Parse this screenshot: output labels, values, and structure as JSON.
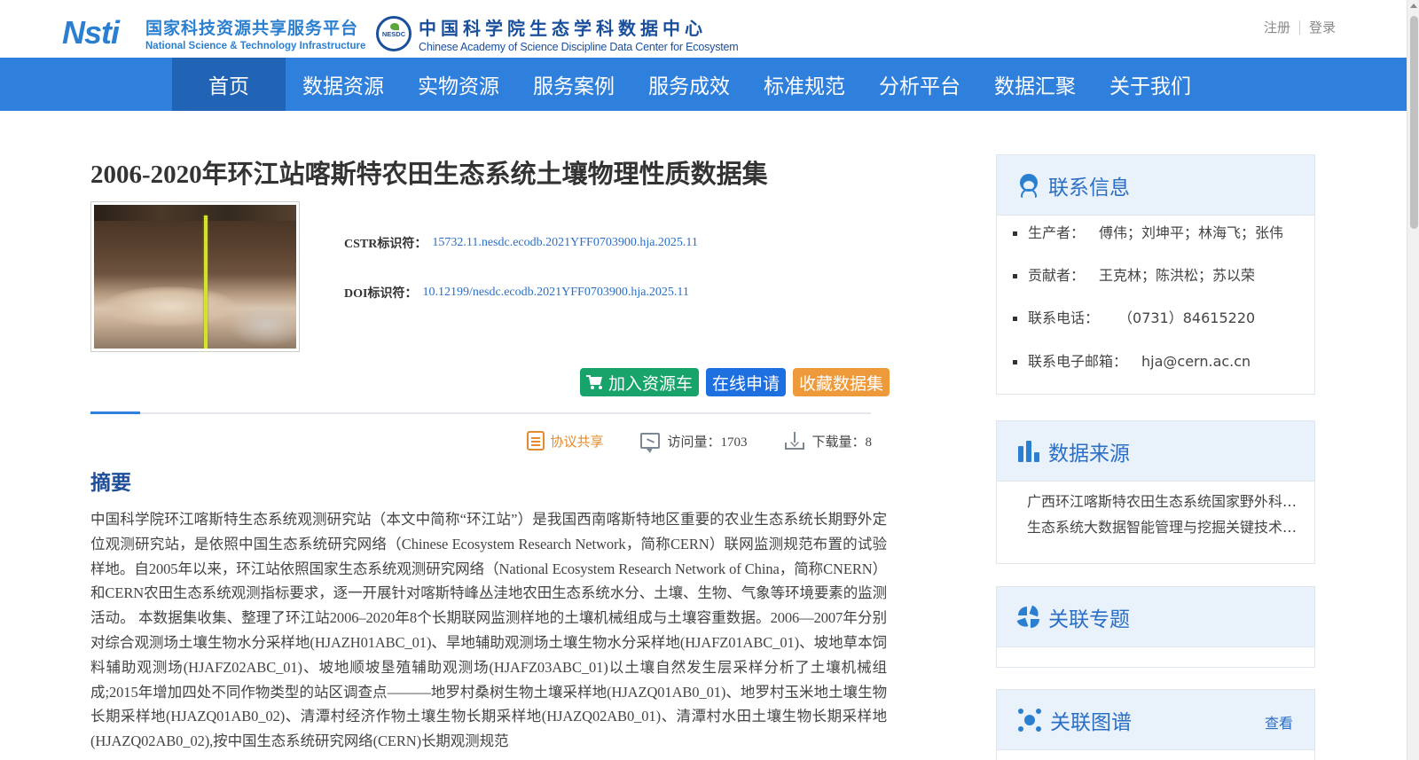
{
  "header": {
    "nsti_mark": "Nsti",
    "nsti_cn": "国家科技资源共享服务平台",
    "nsti_en": "National Science & Technology Infrastructure",
    "nesdc_mark": "NESDC",
    "nesdc_cn": "中国科学院生态学科数据中心",
    "nesdc_en": "Chinese Academy of Science Discipline Data Center for Ecosystem",
    "register": "注册",
    "login": "登录"
  },
  "nav": {
    "items": [
      "首页",
      "数据资源",
      "实物资源",
      "服务案例",
      "服务成效",
      "标准规范",
      "分析平台",
      "数据汇聚",
      "关于我们"
    ],
    "active": "首页"
  },
  "dataset": {
    "title": "2006-2020年环江站喀斯特农田生态系统土壤物理性质数据集",
    "cstr_label": "CSTR标识符：",
    "cstr_value": "15732.11.nesdc.ecodb.2021YFF0703900.hja.2025.11",
    "doi_label": "DOI标识符：",
    "doi_value": "10.12199/nesdc.ecodb.2021YFF0703900.hja.2025.11"
  },
  "buttons": {
    "add_cart": "加入资源车",
    "apply": "在线申请",
    "favorite": "收藏数据集"
  },
  "stats": {
    "share": "协议共享",
    "visits": "访问量：1703",
    "downloads": "下载量：8"
  },
  "abstract": {
    "title": "摘要",
    "text": "中国科学院环江喀斯特生态系统观测研究站（本文中简称“环江站”）是我国西南喀斯特地区重要的农业生态系统长期野外定位观测研究站，是依照中国生态系统研究网络（Chinese Ecosystem Research Network，简称CERN）联网监测规范布置的试验样地。自2005年以来，环江站依照国家生态系统观测研究网络（National Ecosystem Research Network of China，简称CNERN）和CERN农田生态系统观测指标要求，逐一开展针对喀斯特峰丛洼地农田生态系统水分、土壤、生物、气象等环境要素的监测活动。 本数据集收集、整理了环江站2006–2020年8个长期联网监测样地的土壤机械组成与土壤容重数据。2006—2007年分别对综合观测场土壤生物水分采样地(HJAZH01ABC_01)、旱地辅助观测场土壤生物水分采样地(HJAFZ01ABC_01)、坡地草本饲料辅助观测场(HJAFZ02ABC_01)、坡地顺坡垦殖辅助观测场(HJAFZ03ABC_01)以土壤自然发生层采样分析了土壤机械组成;2015年增加四处不同作物类型的站区调查点———地罗村桑树生物土壤采样地(HJAZQ01AB0_01)、地罗村玉米地土壤生物长期采样地(HJAZQ01AB0_02)、清潭村经济作物土壤生物长期采样地(HJAZQ02AB0_01)、清潭村水田土壤生物长期采样地(HJAZQ02AB0_02),按中国生态系统研究网络(CERN)长期观测规范"
  },
  "sidebar": {
    "contact": {
      "title": "联系信息",
      "items": [
        {
          "k": "生产者：",
          "v": "傅伟；刘坤平；林海飞；张伟"
        },
        {
          "k": "贡献者：",
          "v": "王克林；陈洪松；苏以荣"
        },
        {
          "k": "联系电话：",
          "v": "（0731）84615220"
        },
        {
          "k": "联系电子邮箱：",
          "v": "hja@cern.ac.cn"
        }
      ]
    },
    "source": {
      "title": "数据来源",
      "items": [
        "广西环江喀斯特农田生态系统国家野外科学观测研究站",
        "生态系统大数据智能管理与挖掘关键技术研究"
      ]
    },
    "topic": {
      "title": "关联专题"
    },
    "graph": {
      "title": "关联图谱",
      "link": "查看"
    }
  },
  "colors": {
    "nav_bg": "#2f7fdc",
    "nav_active": "#2163b5",
    "link": "#2b6fc4",
    "btn_green": "#17a36a",
    "btn_blue": "#1e6fe0",
    "btn_orange": "#ef9a3a"
  }
}
